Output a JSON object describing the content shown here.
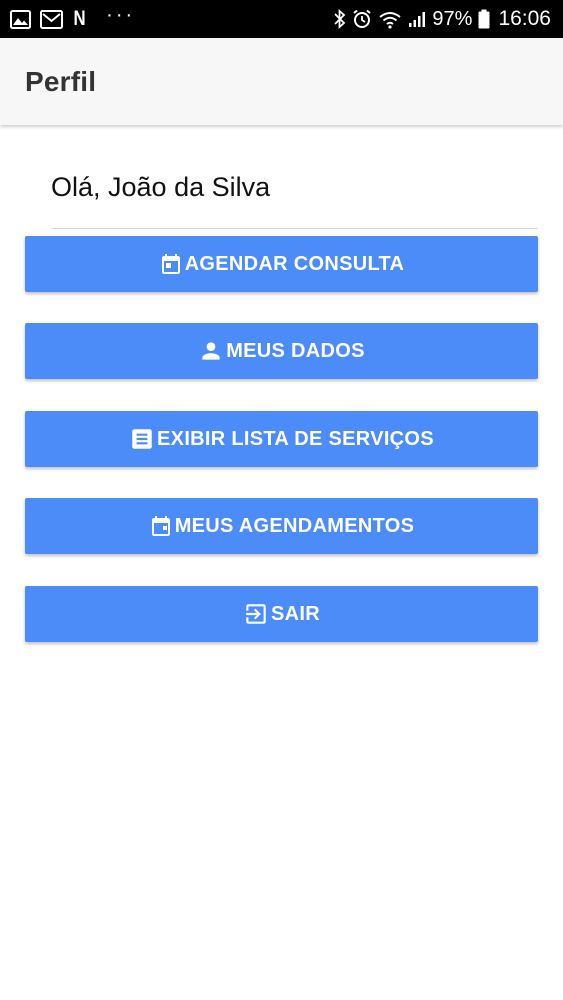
{
  "status_bar": {
    "battery_percent": "97%",
    "time": "16:06",
    "dots": "···",
    "netflix_letter": "N"
  },
  "app_bar": {
    "title": "Perfil"
  },
  "greeting": {
    "text": "Olá, João da Silva"
  },
  "menu": {
    "buttons": [
      {
        "label": "AGENDAR CONSULTA",
        "icon": "calendar-today-icon"
      },
      {
        "label": "MEUS DADOS",
        "icon": "person-icon"
      },
      {
        "label": "EXIBIR LISTA DE SERVIÇOS",
        "icon": "document-list-icon"
      },
      {
        "label": "MEUS AGENDAMENTOS",
        "icon": "calendar-icon"
      },
      {
        "label": "SAIR",
        "icon": "exit-icon"
      }
    ]
  },
  "colors": {
    "button_bg": "#4c8cf8",
    "app_bar_bg": "#f7f7f7",
    "status_bar_bg": "#000000"
  }
}
